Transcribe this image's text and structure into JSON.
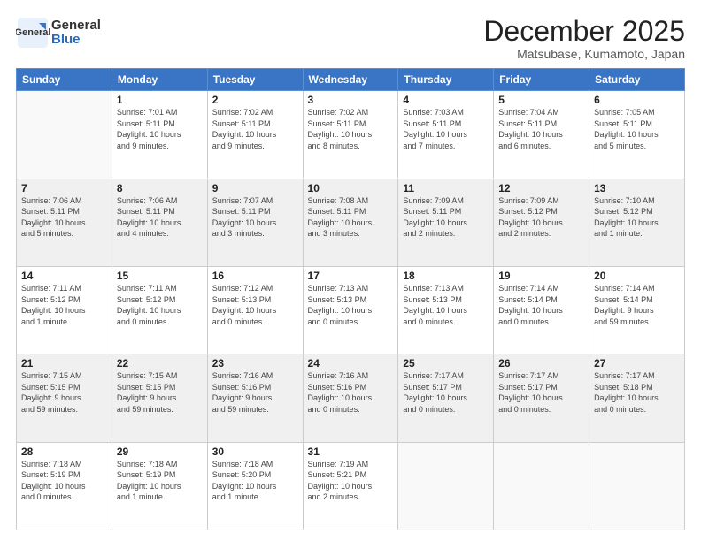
{
  "header": {
    "logo_general": "General",
    "logo_blue": "Blue",
    "title": "December 2025",
    "subtitle": "Matsubase, Kumamoto, Japan"
  },
  "columns": [
    "Sunday",
    "Monday",
    "Tuesday",
    "Wednesday",
    "Thursday",
    "Friday",
    "Saturday"
  ],
  "weeks": [
    {
      "shaded": false,
      "days": [
        {
          "num": "",
          "info": ""
        },
        {
          "num": "1",
          "info": "Sunrise: 7:01 AM\nSunset: 5:11 PM\nDaylight: 10 hours\nand 9 minutes."
        },
        {
          "num": "2",
          "info": "Sunrise: 7:02 AM\nSunset: 5:11 PM\nDaylight: 10 hours\nand 9 minutes."
        },
        {
          "num": "3",
          "info": "Sunrise: 7:02 AM\nSunset: 5:11 PM\nDaylight: 10 hours\nand 8 minutes."
        },
        {
          "num": "4",
          "info": "Sunrise: 7:03 AM\nSunset: 5:11 PM\nDaylight: 10 hours\nand 7 minutes."
        },
        {
          "num": "5",
          "info": "Sunrise: 7:04 AM\nSunset: 5:11 PM\nDaylight: 10 hours\nand 6 minutes."
        },
        {
          "num": "6",
          "info": "Sunrise: 7:05 AM\nSunset: 5:11 PM\nDaylight: 10 hours\nand 5 minutes."
        }
      ]
    },
    {
      "shaded": true,
      "days": [
        {
          "num": "7",
          "info": "Sunrise: 7:06 AM\nSunset: 5:11 PM\nDaylight: 10 hours\nand 5 minutes."
        },
        {
          "num": "8",
          "info": "Sunrise: 7:06 AM\nSunset: 5:11 PM\nDaylight: 10 hours\nand 4 minutes."
        },
        {
          "num": "9",
          "info": "Sunrise: 7:07 AM\nSunset: 5:11 PM\nDaylight: 10 hours\nand 3 minutes."
        },
        {
          "num": "10",
          "info": "Sunrise: 7:08 AM\nSunset: 5:11 PM\nDaylight: 10 hours\nand 3 minutes."
        },
        {
          "num": "11",
          "info": "Sunrise: 7:09 AM\nSunset: 5:11 PM\nDaylight: 10 hours\nand 2 minutes."
        },
        {
          "num": "12",
          "info": "Sunrise: 7:09 AM\nSunset: 5:12 PM\nDaylight: 10 hours\nand 2 minutes."
        },
        {
          "num": "13",
          "info": "Sunrise: 7:10 AM\nSunset: 5:12 PM\nDaylight: 10 hours\nand 1 minute."
        }
      ]
    },
    {
      "shaded": false,
      "days": [
        {
          "num": "14",
          "info": "Sunrise: 7:11 AM\nSunset: 5:12 PM\nDaylight: 10 hours\nand 1 minute."
        },
        {
          "num": "15",
          "info": "Sunrise: 7:11 AM\nSunset: 5:12 PM\nDaylight: 10 hours\nand 0 minutes."
        },
        {
          "num": "16",
          "info": "Sunrise: 7:12 AM\nSunset: 5:13 PM\nDaylight: 10 hours\nand 0 minutes."
        },
        {
          "num": "17",
          "info": "Sunrise: 7:13 AM\nSunset: 5:13 PM\nDaylight: 10 hours\nand 0 minutes."
        },
        {
          "num": "18",
          "info": "Sunrise: 7:13 AM\nSunset: 5:13 PM\nDaylight: 10 hours\nand 0 minutes."
        },
        {
          "num": "19",
          "info": "Sunrise: 7:14 AM\nSunset: 5:14 PM\nDaylight: 10 hours\nand 0 minutes."
        },
        {
          "num": "20",
          "info": "Sunrise: 7:14 AM\nSunset: 5:14 PM\nDaylight: 9 hours\nand 59 minutes."
        }
      ]
    },
    {
      "shaded": true,
      "days": [
        {
          "num": "21",
          "info": "Sunrise: 7:15 AM\nSunset: 5:15 PM\nDaylight: 9 hours\nand 59 minutes."
        },
        {
          "num": "22",
          "info": "Sunrise: 7:15 AM\nSunset: 5:15 PM\nDaylight: 9 hours\nand 59 minutes."
        },
        {
          "num": "23",
          "info": "Sunrise: 7:16 AM\nSunset: 5:16 PM\nDaylight: 9 hours\nand 59 minutes."
        },
        {
          "num": "24",
          "info": "Sunrise: 7:16 AM\nSunset: 5:16 PM\nDaylight: 10 hours\nand 0 minutes."
        },
        {
          "num": "25",
          "info": "Sunrise: 7:17 AM\nSunset: 5:17 PM\nDaylight: 10 hours\nand 0 minutes."
        },
        {
          "num": "26",
          "info": "Sunrise: 7:17 AM\nSunset: 5:17 PM\nDaylight: 10 hours\nand 0 minutes."
        },
        {
          "num": "27",
          "info": "Sunrise: 7:17 AM\nSunset: 5:18 PM\nDaylight: 10 hours\nand 0 minutes."
        }
      ]
    },
    {
      "shaded": false,
      "days": [
        {
          "num": "28",
          "info": "Sunrise: 7:18 AM\nSunset: 5:19 PM\nDaylight: 10 hours\nand 0 minutes."
        },
        {
          "num": "29",
          "info": "Sunrise: 7:18 AM\nSunset: 5:19 PM\nDaylight: 10 hours\nand 1 minute."
        },
        {
          "num": "30",
          "info": "Sunrise: 7:18 AM\nSunset: 5:20 PM\nDaylight: 10 hours\nand 1 minute."
        },
        {
          "num": "31",
          "info": "Sunrise: 7:19 AM\nSunset: 5:21 PM\nDaylight: 10 hours\nand 2 minutes."
        },
        {
          "num": "",
          "info": ""
        },
        {
          "num": "",
          "info": ""
        },
        {
          "num": "",
          "info": ""
        }
      ]
    }
  ]
}
